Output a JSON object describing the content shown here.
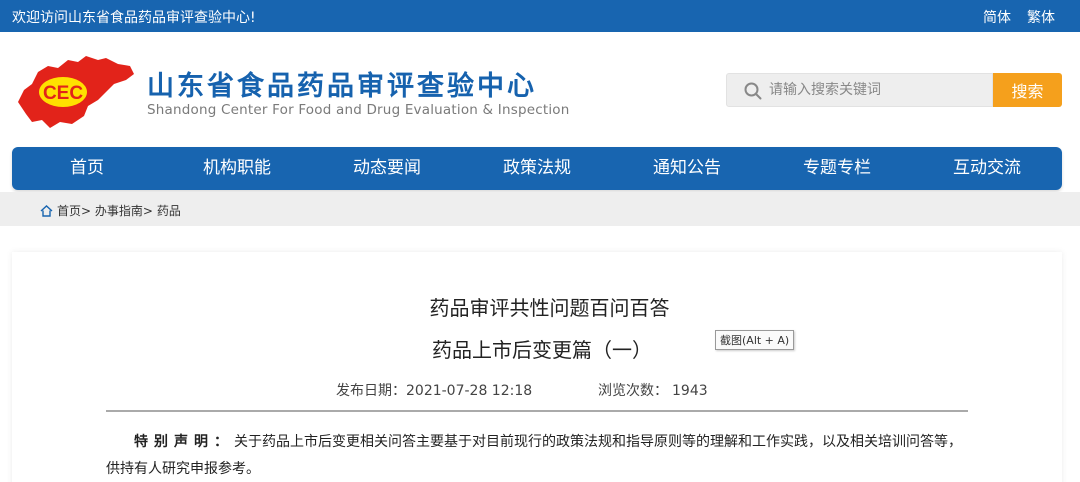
{
  "topbar": {
    "welcome": "欢迎访问山东省食品药品审评查验中心!",
    "lang_simplified": "简体",
    "lang_traditional": "繁体"
  },
  "header": {
    "logo_text": "CEC",
    "title": "山东省食品药品审评查验中心",
    "subtitle": "Shandong Center For Food and Drug Evaluation & Inspection"
  },
  "search": {
    "placeholder": "请输入搜索关键词",
    "value": "",
    "button_label": "搜索"
  },
  "nav": {
    "items": [
      {
        "label": "首页"
      },
      {
        "label": "机构职能"
      },
      {
        "label": "动态要闻"
      },
      {
        "label": "政策法规"
      },
      {
        "label": "通知公告"
      },
      {
        "label": "专题专栏"
      },
      {
        "label": "互动交流"
      }
    ]
  },
  "breadcrumb": {
    "items": [
      "首页",
      "办事指南",
      "药品"
    ],
    "separator": ">"
  },
  "article": {
    "title_line1": "药品审评共性问题百问百答",
    "title_line2": "药品上市后变更篇（一）",
    "tooltip": "截图(Alt + A)",
    "publish_label": "发布日期：",
    "publish_date": "2021-07-28 12:18",
    "views_label": "浏览次数：",
    "views_count": "1943",
    "notice_label": "特别声明：",
    "notice_text": "关于药品上市后变更相关问答主要基于对目前现行的政策法规和指导原则等的理解和工作实践，以及相关培训问答等，供持有人研究申报参考。"
  },
  "colors": {
    "primary_blue": "#1865b0",
    "search_orange": "#f5a01c",
    "logo_red": "#e2231a",
    "logo_yellow": "#ffe000"
  },
  "icons": {
    "logo": "shandong-map-logo",
    "search": "search-icon",
    "home": "home-icon"
  }
}
